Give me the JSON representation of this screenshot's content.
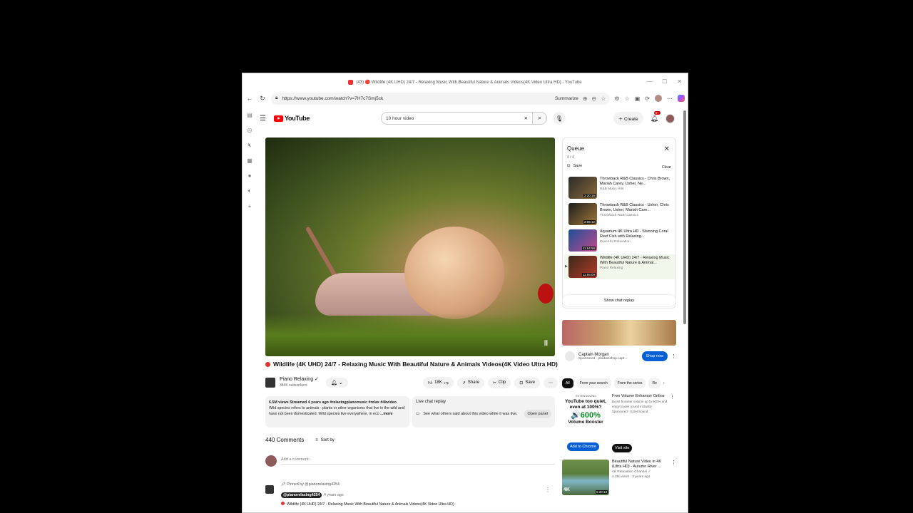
{
  "browser": {
    "tab_title": "(43) 🔴 Wildlife (4K UHD) 24/7 - Relaxing Music With Beautiful Nature & Animals Videos(4K Video Ultra HD) - YouTube",
    "url": "https://www.youtube.com/watch?v=7H7c7Smj5ck",
    "summarize_label": "Summarize"
  },
  "header": {
    "logo_text": "YouTube",
    "search_value": "10 hour video",
    "create_label": "Create",
    "notification_count": "9+"
  },
  "video": {
    "title": "Wildlife (4K UHD) 24/7 - Relaxing Music With Beautiful Nature & Animals Videos(4K Video Ultra HD)",
    "channel_name": "Piano Relaxing",
    "subscribers": "384K subscribers",
    "likes": "18K",
    "share_label": "Share",
    "clip_label": "Clip",
    "save_label": "Save",
    "stats": "6.5M views  Streamed 4 years ago  #relaxingpianomusic #relax #4kvideo",
    "description": "Wild species refers to animals - plants or other organisms that live in the wild and have not been domesticated. Wild species live everywhere, in eco",
    "more_label": "...more"
  },
  "live_chat": {
    "title": "Live chat replay",
    "text": "See what others said about this video while it was live.",
    "open_label": "Open panel"
  },
  "comments": {
    "count_label": "440 Comments",
    "sort_label": "Sort by",
    "add_placeholder": "Add a comment...",
    "pinned_by": "Pinned by @pianorelaxing4254",
    "handle": "@pianorelaxing4254",
    "age": "4 years ago",
    "text": "Wildlife (4K UHD) 24/7 - Relaxing Music With Beautiful Nature & Animals Videos(4K Video Ultra HD)"
  },
  "queue": {
    "title": "Queue",
    "count": "4 / 4",
    "save_label": "Save",
    "clear_label": "Clear",
    "items": [
      {
        "title": "Throwback R&B Classics - Chris Brown, Mariah Carey, Usher, Ne...",
        "channel": "R&B Music Hits",
        "duration": "3:20:16",
        "active": false
      },
      {
        "title": "Throwback R&B Classics - Usher, Chris Brown, Usher, Mariah Care...",
        "channel": "Throwback R&B Classics",
        "duration": "2:06:12",
        "active": false
      },
      {
        "title": "Aquarium 4K Ultra HD - Stunning Coral Reef Fish with Relaxing...",
        "channel": "Peaceful Relaxation",
        "duration": "11:54:58",
        "active": false
      },
      {
        "title": "Wildlife (4K UHD) 24/7 - Relaxing Music With Beautiful Nature & Animal...",
        "channel": "Piano Relaxing",
        "duration": "11:55:00",
        "active": true
      }
    ],
    "chat_replay_label": "Show chat replay"
  },
  "ad1": {
    "advertiser": "Captain Morgan",
    "sponsored": "Sponsored · productshop.capt...",
    "shop_label": "Shop now"
  },
  "chips": [
    "All",
    "From your search",
    "From the series",
    "Re"
  ],
  "ad2": {
    "brand": "EXTENSOUND",
    "headline": "YouTube too quiet, even at 100%?",
    "big": "🔊600%",
    "booster": "Volume Booster",
    "add_label": "Add to Chrome",
    "visit_label": "Visit site",
    "title": "Free Volume Enhancer Online",
    "desc": "Boost browser volume up to 600% and enjoy louder sound instantly",
    "sponsored": "Sponsored · ExtenSound"
  },
  "recommendation": {
    "title": "Beautiful Nature Video in 4K (Ultra HD) - Autumn River ...",
    "channel": "4K Relaxation Channel ✓",
    "meta": "4.3M views · 3 years ago",
    "duration": "5:30:13",
    "badge": "4K"
  }
}
